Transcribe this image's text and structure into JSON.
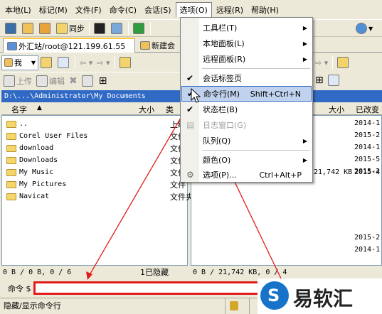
{
  "menubar": {
    "items": [
      "本地(L)",
      "标记(M)",
      "文件(F)",
      "命令(C)",
      "会话(S)",
      "选项(O)",
      "远程(R)",
      "帮助(H)"
    ]
  },
  "toolbar": {
    "sync_label": "同步"
  },
  "tabs": {
    "session_tab": "外汇站/root@121.199.61.55",
    "new_tab": "新建会"
  },
  "local_toolbar": {
    "drive_label": "我",
    "upload_label": "上传",
    "edit_label": "编辑"
  },
  "local_pane": {
    "path": "D:\\...\\Administrator\\My Documents",
    "columns": {
      "name": "名字",
      "size": "大小",
      "type": "类型"
    },
    "rows": [
      {
        "name": "..",
        "type": "上级"
      },
      {
        "name": "Corel User Files",
        "type": "文件"
      },
      {
        "name": "download",
        "type": "文件"
      },
      {
        "name": "Downloads",
        "type": "文件"
      },
      {
        "name": "My Music",
        "type": "文件"
      },
      {
        "name": "My Pictures",
        "type": "文件"
      },
      {
        "name": "Navicat",
        "type": "文件夹"
      }
    ],
    "status": "0 B / 0 B, 0 / 6",
    "hidden_count": "1已隐藏"
  },
  "remote_pane": {
    "columns": {
      "size": "大小",
      "modified": "已改变"
    },
    "rows": [
      {
        "size": "",
        "modified": "2014-1"
      },
      {
        "size": "",
        "modified": "2015-2"
      },
      {
        "size": "",
        "modified": "2014-1"
      },
      {
        "size": "",
        "modified": "2015-5"
      },
      {
        "size": "",
        "modified": "2015-2"
      },
      {
        "size": "21,742 KB",
        "modified": "2015-4"
      },
      {
        "size": "",
        "modified": "2014-1"
      }
    ],
    "extra_dates": [
      "2015-2",
      "2014-1"
    ],
    "status": "0 B / 21,742 KB, 0 / 4"
  },
  "command": {
    "label": "命令 $",
    "value": ""
  },
  "bottombar": {
    "hint": "隐藏/显示命令行"
  },
  "options_menu": {
    "items": [
      {
        "label": "工具栏(T)",
        "submenu": true
      },
      {
        "label": "本地面板(L)",
        "submenu": true
      },
      {
        "label": "远程面板(R)",
        "submenu": true
      },
      {
        "label": "会话标签页",
        "checked": true
      },
      {
        "label": "命令行(M)",
        "shortcut": "Shift+Ctrl+N",
        "checked": true,
        "highlighted": true
      },
      {
        "label": "状态栏(B)",
        "checked": true
      },
      {
        "label": "日志窗口(G)",
        "disabled": true
      },
      {
        "label": "队列(Q)",
        "submenu": true
      },
      {
        "label": "颜色(O)",
        "submenu": true
      },
      {
        "label": "选项(P)...",
        "shortcut": "Ctrl+Alt+P"
      }
    ]
  },
  "watermark": {
    "text": "易软汇"
  },
  "colors": {
    "path_bar": "#316ac5",
    "menu_highlight": "#c1d2ee",
    "annotation_red": "#e21b1b",
    "window_bg": "#ece9d8"
  }
}
